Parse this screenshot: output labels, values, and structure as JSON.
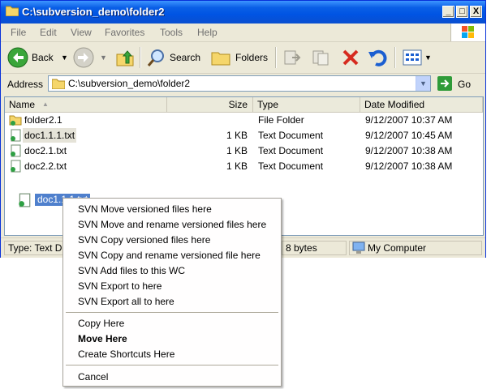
{
  "window": {
    "title": "C:\\subversion_demo\\folder2",
    "caption_buttons": [
      "_",
      "□",
      "X"
    ]
  },
  "menubar": [
    "File",
    "Edit",
    "View",
    "Favorites",
    "Tools",
    "Help"
  ],
  "toolbar": {
    "back": "Back",
    "search": "Search",
    "folders": "Folders"
  },
  "address": {
    "label": "Address",
    "path": "C:\\subversion_demo\\folder2",
    "go": "Go"
  },
  "columns": {
    "name": "Name",
    "size": "Size",
    "type": "Type",
    "date": "Date Modified"
  },
  "files": [
    {
      "name": "folder2.1",
      "size": "",
      "type": "File Folder",
      "date": "9/12/2007 10:37 AM",
      "icon": "svn-folder-icon"
    },
    {
      "name": "doc1.1.1.txt",
      "size": "1 KB",
      "type": "Text Document",
      "date": "9/12/2007 10:45 AM",
      "icon": "svn-file-icon"
    },
    {
      "name": "doc2.1.txt",
      "size": "1 KB",
      "type": "Text Document",
      "date": "9/12/2007 10:38 AM",
      "icon": "svn-file-icon"
    },
    {
      "name": "doc2.2.txt",
      "size": "1 KB",
      "type": "Text Document",
      "date": "9/12/2007 10:38 AM",
      "icon": "svn-file-icon"
    }
  ],
  "drag_label": "doc1.1.1.txt",
  "status": {
    "left": "Type: Text D",
    "size": "8 bytes",
    "zone": "My Computer"
  },
  "context_menu": {
    "svn_items": [
      "SVN Move versioned files here",
      "SVN Move and rename versioned files here",
      "SVN Copy versioned files here",
      "SVN Copy and rename versioned file here",
      "SVN Add files to this WC",
      "SVN Export to here",
      "SVN Export all to here"
    ],
    "copy_here": "Copy Here",
    "move_here": "Move Here",
    "create_shortcuts": "Create Shortcuts Here",
    "cancel": "Cancel"
  }
}
